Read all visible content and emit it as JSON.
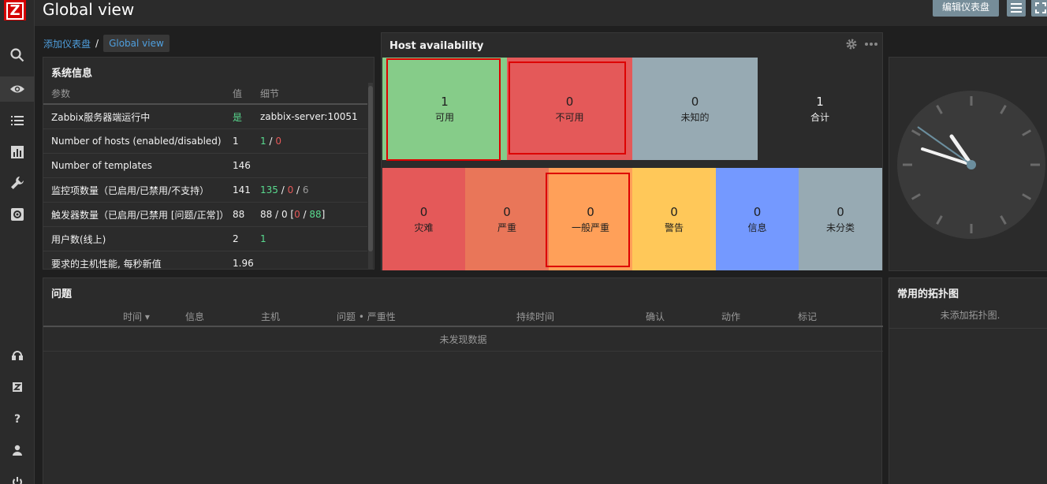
{
  "app": {
    "logo": "Z"
  },
  "header": {
    "title": "Global view",
    "edit_label": "编辑仪表盘"
  },
  "breadcrumb": {
    "parent": "添加仪表盘",
    "sep": "/",
    "current": "Global view"
  },
  "system_info": {
    "title": "系统信息",
    "columns": [
      "参数",
      "值",
      "细节"
    ],
    "rows": [
      {
        "param": "Zabbix服务器端运行中",
        "value": "是",
        "detail": "zabbix-server:10051"
      },
      {
        "param": "Number of hosts (enabled/disabled)",
        "value": "1",
        "d1": "1",
        "d2": "0"
      },
      {
        "param": "Number of templates",
        "value": "146"
      },
      {
        "param": "监控项数量（已启用/已禁用/不支持）",
        "value": "141",
        "d1": "135",
        "d2": "0",
        "d3": "6"
      },
      {
        "param": "触发器数量（已启用/已禁用 [问题/正常]）",
        "value": "88",
        "d0": "88 / 0 [",
        "d1": "0",
        "d2": "88",
        "d3": "]"
      },
      {
        "param": "用户数(线上)",
        "value": "2",
        "d1": "1"
      },
      {
        "param": "要求的主机性能, 每秒新值",
        "value": "1.96"
      }
    ]
  },
  "host_availability": {
    "title": "Host availability",
    "availability": [
      {
        "count": "1",
        "label": "可用",
        "color": "#86cc89"
      },
      {
        "count": "0",
        "label": "不可用",
        "color": "#e45959"
      },
      {
        "count": "0",
        "label": "未知的",
        "color": "#97aab3"
      },
      {
        "count": "1",
        "label": "合计",
        "color": "#2b2b2b"
      }
    ],
    "severities": [
      {
        "count": "0",
        "label": "灾难",
        "color": "#e45959"
      },
      {
        "count": "0",
        "label": "严重",
        "color": "#e97659"
      },
      {
        "count": "0",
        "label": "一般严重",
        "color": "#ffa059"
      },
      {
        "count": "0",
        "label": "警告",
        "color": "#ffc859"
      },
      {
        "count": "0",
        "label": "信息",
        "color": "#7499ff"
      },
      {
        "count": "0",
        "label": "未分类",
        "color": "#97aab3"
      }
    ]
  },
  "problems": {
    "title": "问题",
    "columns": [
      "时间 ▾",
      "信息",
      "主机",
      "问题 • 严重性",
      "持续时间",
      "确认",
      "动作",
      "标记"
    ],
    "empty": "未发现数据"
  },
  "maps": {
    "title": "常用的拓扑图",
    "empty": "未添加拓扑图."
  }
}
